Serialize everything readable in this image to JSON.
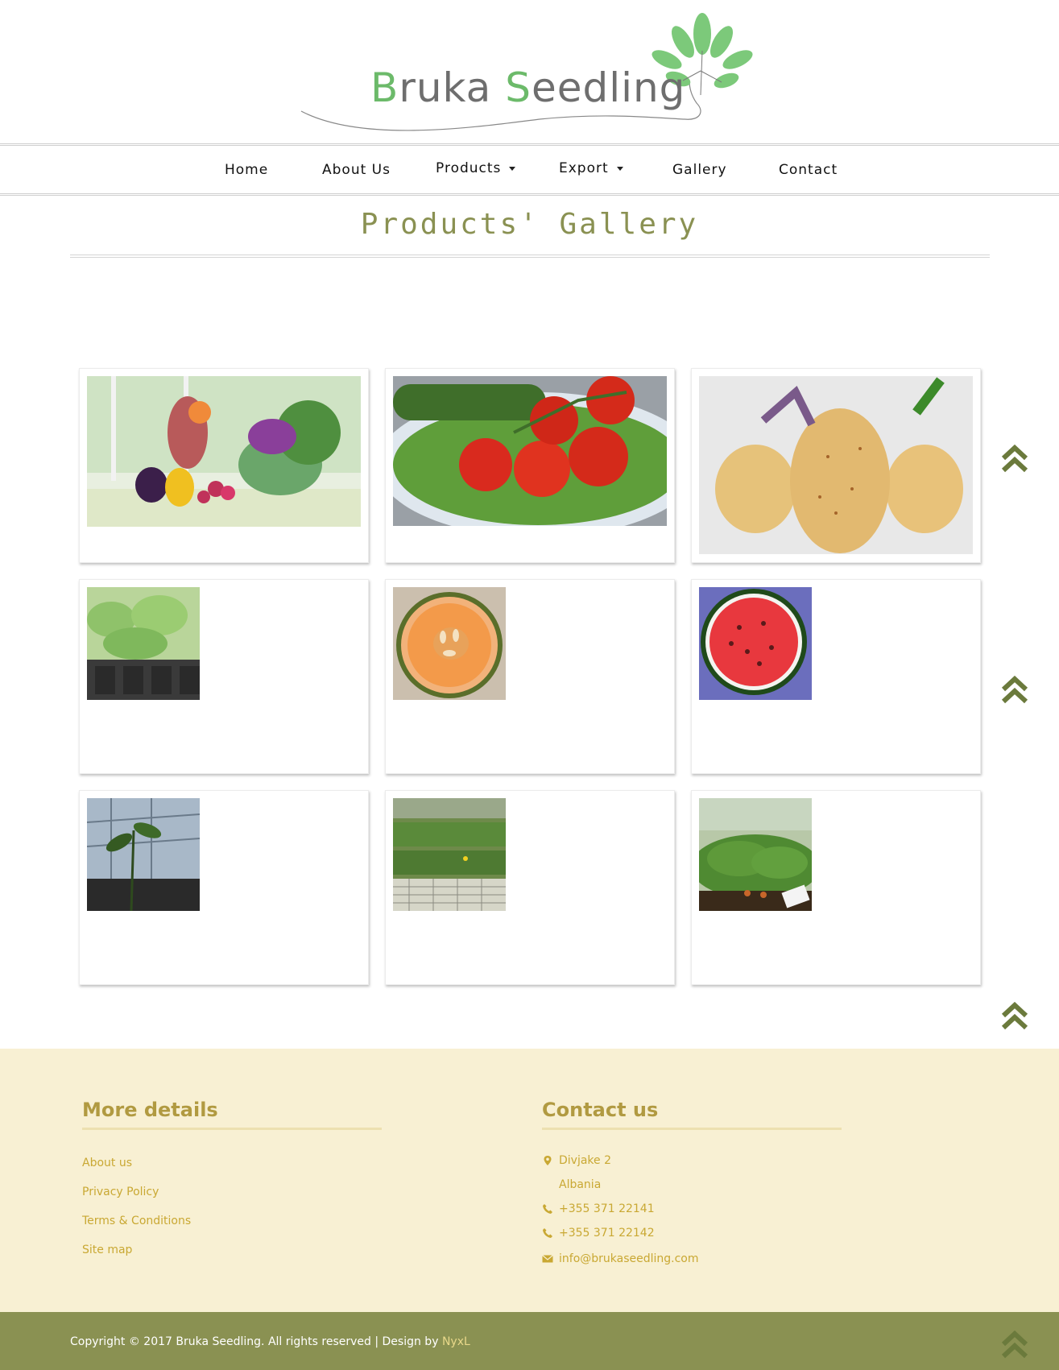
{
  "logo": {
    "word1_initial": "B",
    "word1_rest": "ruka",
    "word2_initial": "S",
    "word2_rest": "eedling"
  },
  "nav": {
    "items": [
      {
        "label": "Home",
        "has_dropdown": false
      },
      {
        "label": "About Us",
        "has_dropdown": false
      },
      {
        "label": "Products",
        "has_dropdown": true
      },
      {
        "label": "Export",
        "has_dropdown": true
      },
      {
        "label": "Gallery",
        "has_dropdown": false
      },
      {
        "label": "Contact",
        "has_dropdown": false
      }
    ]
  },
  "page_title": "Products' Gallery",
  "gallery": {
    "images": [
      {
        "subject": "vegetables-still-life"
      },
      {
        "subject": "tomatoes-cucumber-bowl"
      },
      {
        "subject": "potatoes"
      },
      {
        "subject": "seedling-trays"
      },
      {
        "subject": "melon-half"
      },
      {
        "subject": "watermelon-half"
      },
      {
        "subject": "greenhouse-seedling"
      },
      {
        "subject": "greenhouse-trays"
      },
      {
        "subject": "potted-seedlings"
      }
    ]
  },
  "footer": {
    "more_details": {
      "heading": "More details",
      "links": [
        "About us",
        "Privacy Policy",
        "Terms & Conditions",
        "Site map"
      ]
    },
    "contact": {
      "heading": "Contact us",
      "address_line1": "Divjake 2",
      "address_line2": "Albania",
      "phone1": "+355 371 22141",
      "phone2": "+355 371 22142",
      "email": "info@brukaseedling.com"
    },
    "copyright_text": "Copyright © 2017 Bruka Seedling. All rights reserved | Design by ",
    "designer": "NyxL"
  },
  "colors": {
    "accent_green": "#8a9152",
    "logo_green": "#6cba6a",
    "footer_bg": "#f8f0d3",
    "footer_text": "#c9a833",
    "footer_heading": "#b19a41"
  }
}
